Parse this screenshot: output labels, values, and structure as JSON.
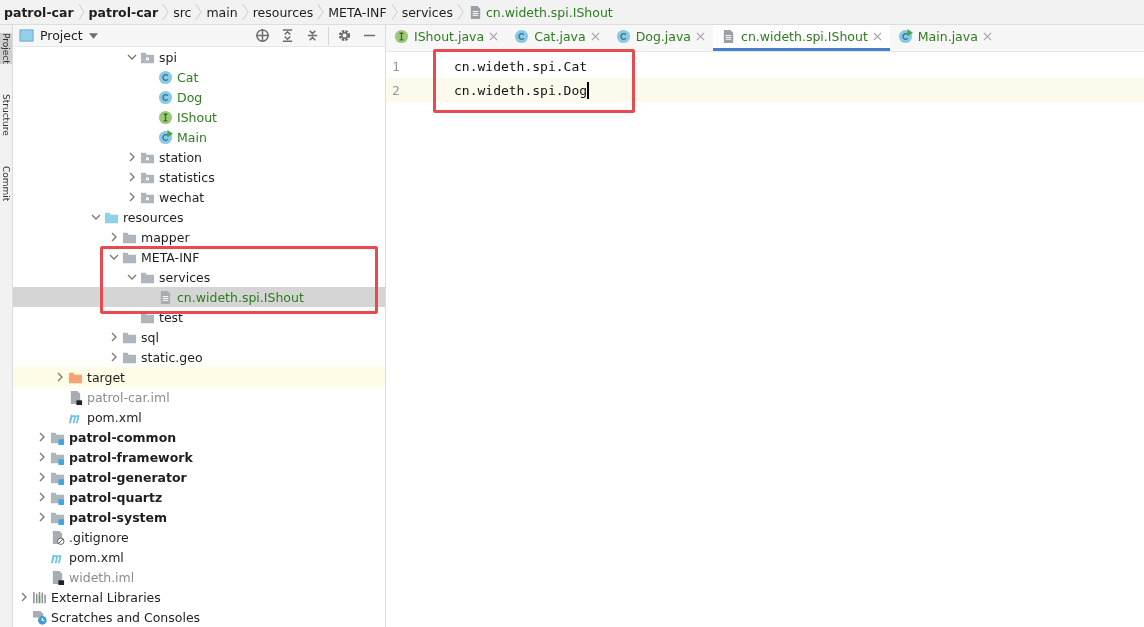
{
  "breadcrumbs": [
    {
      "label": "patrol-car",
      "kind": "module"
    },
    {
      "label": "patrol-car",
      "kind": "module"
    },
    {
      "label": "src",
      "kind": "folder"
    },
    {
      "label": "main",
      "kind": "folder"
    },
    {
      "label": "resources",
      "kind": "folder"
    },
    {
      "label": "META-INF",
      "kind": "folder"
    },
    {
      "label": "services",
      "kind": "folder"
    },
    {
      "label": "cn.wideth.spi.IShout",
      "kind": "file"
    }
  ],
  "tool_windows": [
    {
      "label": "Project",
      "selected": true
    },
    {
      "label": "Structure",
      "selected": false
    },
    {
      "label": "Commit",
      "selected": false
    }
  ],
  "project_panel": {
    "title": "Project"
  },
  "tree": [
    {
      "children": [
        {
          "children": [
            {
              "children": [
                {
                  "children": [
                    {
                      "children": [
                        {
                          "children": [
                            {
                              "label": "spi",
                              "kind": "package",
                              "expanded": true,
                              "selected": false,
                              "highlighted": false,
                              "children": [
                                {
                                  "label": "Cat",
                                  "kind": "class",
                                  "color": "#2d7d1e",
                                  "selected": false,
                                  "highlighted": false
                                },
                                {
                                  "label": "Dog",
                                  "kind": "class",
                                  "color": "#2d7d1e",
                                  "selected": false,
                                  "highlighted": false
                                },
                                {
                                  "label": "IShout",
                                  "kind": "interface",
                                  "color": "#2d7d1e",
                                  "selected": false,
                                  "highlighted": false
                                },
                                {
                                  "label": "Main",
                                  "kind": "main_class",
                                  "color": "#2d7d1e",
                                  "selected": false,
                                  "highlighted": false
                                }
                              ]
                            },
                            {
                              "label": "station",
                              "kind": "package",
                              "expanded": false,
                              "selected": false,
                              "highlighted": false
                            },
                            {
                              "label": "statistics",
                              "kind": "package",
                              "expanded": false,
                              "selected": false,
                              "highlighted": false
                            },
                            {
                              "label": "wechat",
                              "kind": "package",
                              "expanded": false,
                              "selected": false,
                              "highlighted": false
                            }
                          ]
                        }
                      ]
                    },
                    {
                      "label": "resources",
                      "kind": "resources_folder",
                      "expanded": true,
                      "selected": false,
                      "highlighted": false,
                      "children": [
                        {
                          "label": "mapper",
                          "kind": "folder",
                          "expanded": false,
                          "selected": false,
                          "highlighted": false
                        },
                        {
                          "label": "META-INF",
                          "kind": "folder",
                          "expanded": true,
                          "selected": false,
                          "highlighted": false,
                          "children": [
                            {
                              "label": "services",
                              "kind": "folder",
                              "expanded": true,
                              "selected": false,
                              "highlighted": false,
                              "children": [
                                {
                                  "label": "cn.wideth.spi.IShout",
                                  "kind": "text_file",
                                  "color": "#2d7d1e",
                                  "selected": true,
                                  "highlighted": false
                                }
                              ]
                            },
                            {
                              "label": "test",
                              "kind": "folder",
                              "selected": false,
                              "highlighted": false
                            }
                          ]
                        },
                        {
                          "label": "sql",
                          "kind": "folder",
                          "expanded": false,
                          "selected": false,
                          "highlighted": false
                        },
                        {
                          "label": "static.geo",
                          "kind": "folder",
                          "expanded": false,
                          "selected": false,
                          "highlighted": false
                        }
                      ]
                    }
                  ]
                }
              ]
            },
            {
              "label": "target",
              "kind": "excluded_folder",
              "expanded": false,
              "selected": false,
              "highlighted": true
            },
            {
              "label": "patrol-car.iml",
              "kind": "iml",
              "color": "#8c8c8c",
              "selected": false,
              "highlighted": false
            },
            {
              "label": "pom.xml",
              "kind": "maven",
              "selected": false,
              "highlighted": false
            }
          ]
        },
        {
          "label": "patrol-common",
          "kind": "module",
          "expanded": false,
          "selected": false,
          "highlighted": false
        },
        {
          "label": "patrol-framework",
          "kind": "module",
          "expanded": false,
          "selected": false,
          "highlighted": false
        },
        {
          "label": "patrol-generator",
          "kind": "module",
          "expanded": false,
          "selected": false,
          "highlighted": false
        },
        {
          "label": "patrol-quartz",
          "kind": "module",
          "expanded": false,
          "selected": false,
          "highlighted": false
        },
        {
          "label": "patrol-system",
          "kind": "module",
          "expanded": false,
          "selected": false,
          "highlighted": false
        },
        {
          "label": ".gitignore",
          "kind": "gitignore",
          "selected": false,
          "highlighted": false
        },
        {
          "label": "pom.xml",
          "kind": "maven",
          "selected": false,
          "highlighted": false
        },
        {
          "label": "wideth.iml",
          "kind": "iml",
          "color": "#8c8c8c",
          "selected": false,
          "highlighted": false
        }
      ]
    },
    {
      "label": "External Libraries",
      "kind": "libraries",
      "expanded": false,
      "selected": false,
      "highlighted": false
    },
    {
      "label": "Scratches and Consoles",
      "kind": "scratches",
      "selected": false,
      "highlighted": false
    }
  ],
  "tabs": [
    {
      "label": "IShout.java",
      "kind": "interface",
      "selected": false
    },
    {
      "label": "Cat.java",
      "kind": "class",
      "selected": false
    },
    {
      "label": "Dog.java",
      "kind": "class",
      "selected": false
    },
    {
      "label": "cn.wideth.spi.IShout",
      "kind": "text_file",
      "selected": true
    },
    {
      "label": "Main.java",
      "kind": "main_class",
      "selected": false
    }
  ],
  "editor": {
    "lines": [
      {
        "number": "1",
        "text": "cn.wideth.spi.Cat",
        "current": false
      },
      {
        "number": "2",
        "text": "cn.wideth.spi.Dog",
        "current": true
      }
    ]
  }
}
